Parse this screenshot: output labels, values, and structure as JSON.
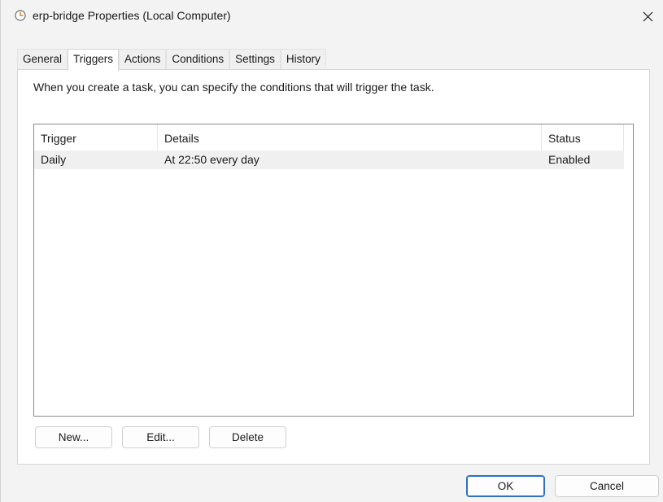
{
  "window": {
    "title": "erp-bridge Properties (Local Computer)",
    "icon": "clock-icon"
  },
  "tabs": [
    {
      "label": "General",
      "active": false
    },
    {
      "label": "Triggers",
      "active": true
    },
    {
      "label": "Actions",
      "active": false
    },
    {
      "label": "Conditions",
      "active": false
    },
    {
      "label": "Settings",
      "active": false
    },
    {
      "label": "History",
      "active": false
    }
  ],
  "triggers_panel": {
    "description": "When you create a task, you can specify the conditions that will trigger the task.",
    "columns": [
      "Trigger",
      "Details",
      "Status"
    ],
    "rows": [
      {
        "trigger": "Daily",
        "details": "At 22:50 every day",
        "status": "Enabled"
      }
    ],
    "buttons": {
      "new": "New...",
      "edit": "Edit...",
      "delete": "Delete"
    }
  },
  "dialog_buttons": {
    "ok": "OK",
    "cancel": "Cancel"
  },
  "colors": {
    "accent": "#2f6fc4",
    "window_bg": "#f3f3f3",
    "selected_row": "#f0f0f0"
  }
}
